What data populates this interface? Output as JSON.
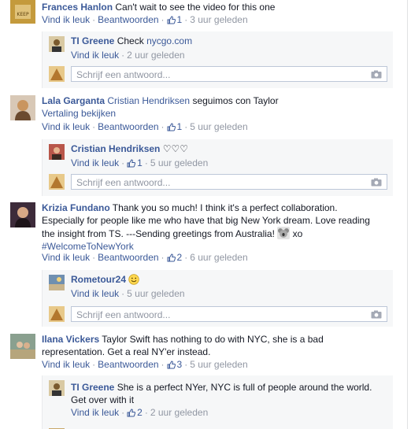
{
  "comments": [
    {
      "author": "Frances Hanlon",
      "text": "Can't wait to see the video for this one",
      "like": "Vind ik leuk",
      "reply": "Beantwoorden",
      "likes": "1",
      "time": "3 uur geleden",
      "replies": [
        {
          "author": "TI Greene",
          "text": "Check",
          "link": "nycgo.com",
          "like": "Vind ik leuk",
          "time": "2 uur geleden"
        }
      ],
      "reply_placeholder": "Schrijf een antwoord..."
    },
    {
      "author": "Lala Garganta",
      "mention": "Cristian Hendriksen",
      "text": "seguimos con Taylor",
      "translate": "Vertaling bekijken",
      "like": "Vind ik leuk",
      "reply": "Beantwoorden",
      "likes": "1",
      "time": "5 uur geleden",
      "replies": [
        {
          "author": "Cristian Hendriksen",
          "text": "♡♡♡",
          "like": "Vind ik leuk",
          "likes": "1",
          "time": "5 uur geleden"
        }
      ],
      "reply_placeholder": "Schrijf een antwoord..."
    },
    {
      "author": "Krizia Fundano",
      "text_lines": [
        "Thank you so much! I think it's a perfect collaboration.",
        "Especially for people like me who have that big New York dream. Love reading",
        "the insight from TS. ---Sending greetings from Australia!",
        "xo"
      ],
      "hashtag": "#WelcomeToNewYork",
      "like": "Vind ik leuk",
      "reply": "Beantwoorden",
      "likes": "2",
      "time": "6 uur geleden",
      "replies": [
        {
          "author": "Rometour24",
          "like": "Vind ik leuk",
          "time": "5 uur geleden"
        }
      ],
      "reply_placeholder": "Schrijf een antwoord..."
    },
    {
      "author": "Ilana Vickers",
      "text_lines": [
        "Taylor Swift has nothing to do with NYC, she is a bad",
        "representation. Get a real NY'er instead."
      ],
      "like": "Vind ik leuk",
      "reply": "Beantwoorden",
      "likes": "3",
      "time": "5 uur geleden",
      "replies": [
        {
          "author": "TI Greene",
          "text_lines": [
            "She is a perfect NYer, NYC is full of people around the world.",
            "Get over with it"
          ],
          "like": "Vind ik leuk",
          "likes": "2",
          "time": "2 uur geleden"
        }
      ]
    }
  ],
  "colors": {
    "link": "#3b5998",
    "muted": "#9197a3",
    "reply_bg": "#f6f7f8"
  },
  "icons": [
    "thumbs-up-icon",
    "camera-icon",
    "smiley-icon",
    "koala-emoji-icon"
  ]
}
